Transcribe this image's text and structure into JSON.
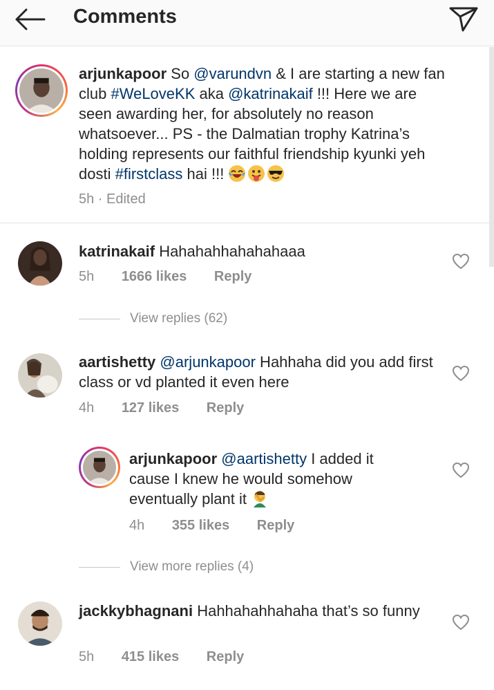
{
  "header": {
    "title": "Comments"
  },
  "caption": {
    "username": "arjunkapoor",
    "parts": [
      {
        "t": "So ",
        "link": false
      },
      {
        "t": "@varundvn",
        "link": true
      },
      {
        "t": " & I are starting a new fan club ",
        "link": false
      },
      {
        "t": "#WeLoveKK",
        "link": true
      },
      {
        "t": " aka ",
        "link": false
      },
      {
        "t": "@katrinakaif",
        "link": true
      },
      {
        "t": " !!! Here we are seen awarding her, for absolutely no reason whatsoever... PS - the Dalmatian trophy Katrina’s holding represents our faithful friendship kyunki yeh dosti ",
        "link": false
      },
      {
        "t": "#firstclass",
        "link": true
      },
      {
        "t": " hai !!! ",
        "link": false
      }
    ],
    "emojis": [
      "laughing-face-emoji",
      "tongue-face-emoji",
      "sunglasses-face-emoji"
    ],
    "meta": "5h · Edited"
  },
  "comments": {
    "katrina": {
      "username": "katrinakaif",
      "text": "Hahahahhahahahaaa",
      "time": "5h",
      "likes": "1666 likes",
      "reply": "Reply",
      "view_replies": "View replies (62)"
    },
    "aarti": {
      "username": "aartishetty",
      "mention": "@arjunkapoor",
      "text": " Hahhaha did you add first class or vd planted it even here",
      "time": "4h",
      "likes": "127 likes",
      "reply": "Reply"
    },
    "arjun_reply": {
      "username": "arjunkapoor",
      "mention": "@aartishetty",
      "text": " I added it cause I knew he would somehow eventually plant it ",
      "emoji": "man-facepalming-emoji",
      "time": "4h",
      "likes": "355 likes",
      "reply": "Reply",
      "view_more": "View more replies (4)"
    },
    "jackky": {
      "username": "jackkybhagnani",
      "text": "Hahhahahhahaha that’s so funny",
      "time": "5h",
      "likes": "415 likes",
      "reply": "Reply"
    }
  },
  "colors": {
    "link": "#003569",
    "muted": "#8e8e8e",
    "text": "#262626"
  }
}
